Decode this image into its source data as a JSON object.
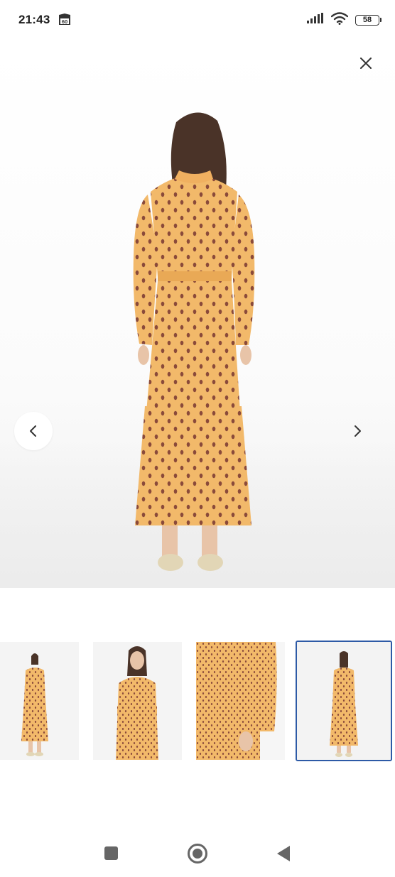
{
  "status_bar": {
    "time": "21:43",
    "notification_badge": "60",
    "battery_level": "58",
    "icons": [
      "signal-icon",
      "wifi-icon",
      "battery-icon"
    ]
  },
  "viewer": {
    "close_icon": "close-icon",
    "prev_icon": "chevron-left-icon",
    "next_icon": "chevron-right-icon",
    "main_image_alt": "product-photo-back-view",
    "thumbnails": [
      {
        "label": "front-view"
      },
      {
        "label": "front-view-closeup"
      },
      {
        "label": "detail-view"
      },
      {
        "label": "back-view",
        "selected": true
      }
    ]
  },
  "colors": {
    "accent": "#2d5aa6",
    "dress": "#f2b96a",
    "dots": "#8a4a3a",
    "nav_icons": "#666666"
  },
  "navigation_bar": {
    "icons": [
      "recent-apps-icon",
      "home-icon",
      "back-icon"
    ]
  }
}
